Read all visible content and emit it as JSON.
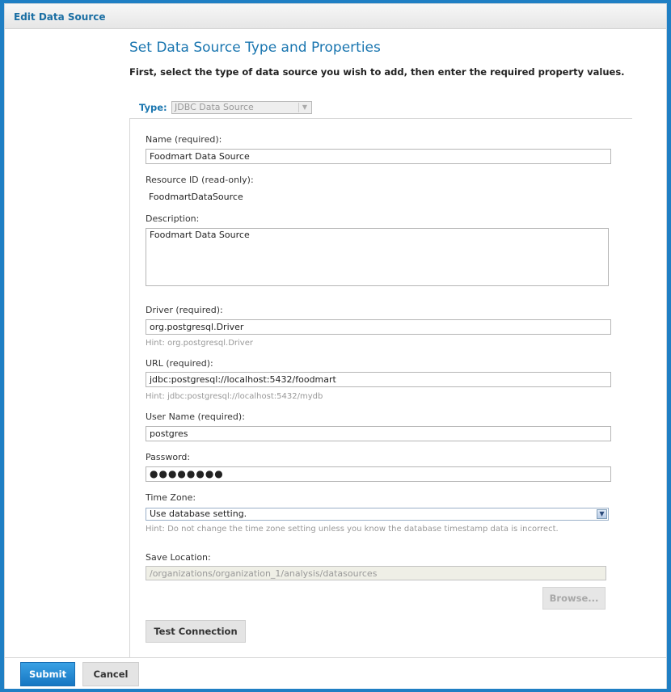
{
  "window": {
    "title": "Edit Data Source"
  },
  "page": {
    "heading": "Set Data Source Type and Properties",
    "subheading": "First, select the type of data source you wish to add, then enter the required property values."
  },
  "type": {
    "label": "Type:",
    "value": "JDBC Data Source"
  },
  "form": {
    "name": {
      "label": "Name (required):",
      "value": "Foodmart Data Source"
    },
    "resource_id": {
      "label": "Resource ID (read-only):",
      "value": "FoodmartDataSource"
    },
    "description": {
      "label": "Description:",
      "value": "Foodmart Data Source"
    },
    "driver": {
      "label": "Driver (required):",
      "value": "org.postgresql.Driver",
      "hint": "Hint: org.postgresql.Driver"
    },
    "url": {
      "label": "URL (required):",
      "value": "jdbc:postgresql://localhost:5432/foodmart",
      "hint": "Hint: jdbc:postgresql://localhost:5432/mydb"
    },
    "username": {
      "label": "User Name (required):",
      "value": "postgres"
    },
    "password": {
      "label": "Password:",
      "value": "●●●●●●●●"
    },
    "timezone": {
      "label": "Time Zone:",
      "value": "Use database setting.",
      "hint": "Hint: Do not change the time zone setting unless you know the database timestamp data is incorrect."
    },
    "save_location": {
      "label": "Save Location:",
      "value": "/organizations/organization_1/analysis/datasources"
    }
  },
  "buttons": {
    "browse": "Browse...",
    "test_connection": "Test Connection",
    "submit": "Submit",
    "cancel": "Cancel"
  },
  "icons": {
    "dropdown": "chevron-down-icon"
  },
  "colors": {
    "accent": "#1a76b0",
    "frame": "#1f7fc4",
    "submit": "#1676c2"
  }
}
